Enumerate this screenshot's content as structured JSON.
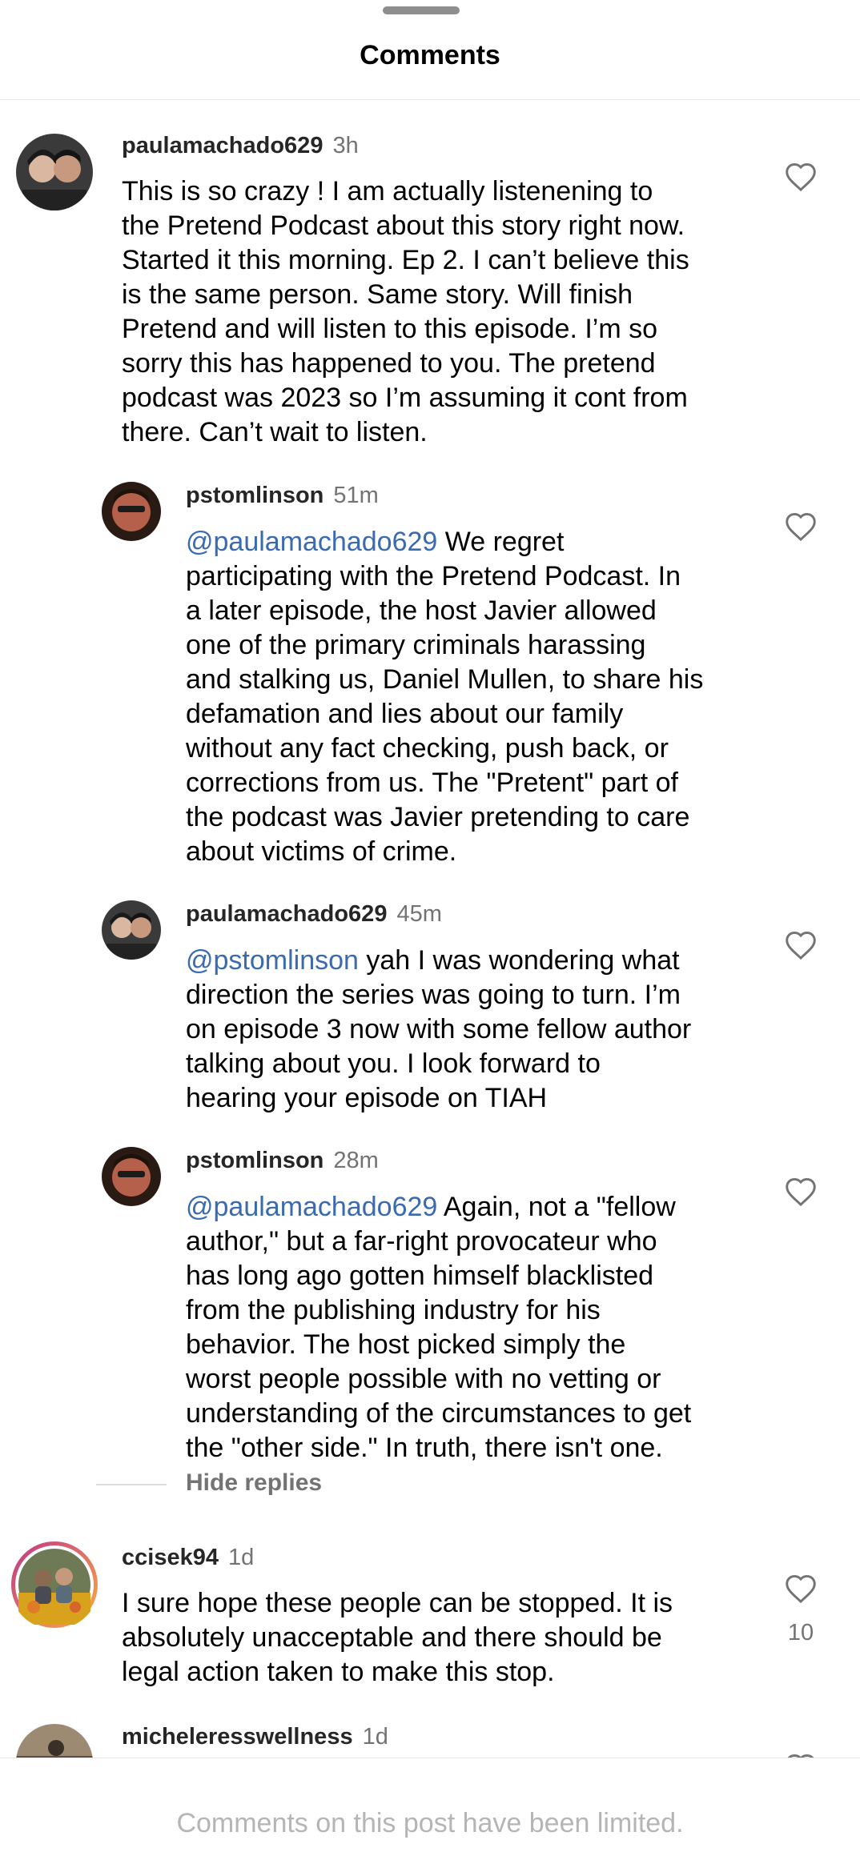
{
  "header": {
    "title": "Comments"
  },
  "comments": [
    {
      "username": "paulamachado629",
      "time": "3h",
      "mention": "",
      "text": "This is so crazy ! I am actually listenening to\nthe Pretend Podcast about this story right now.\nStarted it this morning. Ep 2. I can’t believe this\nis the same person. Same story. Will finish\nPretend and will listen to this episode. I’m so\nsorry this has happened to you. The pretend\npodcast was 2023 so I’m assuming it cont from\nthere. Can’t wait to listen."
    },
    {
      "username": "pstomlinson",
      "time": "51m",
      "mention": "@paulamachado629",
      "text": " We regret\nparticipating with the Pretend Podcast. In\na later episode, the host Javier allowed\none of the primary criminals harassing\nand stalking us, Daniel Mullen, to share his\ndefamation and lies about our family\nwithout any fact checking, push back, or\ncorrections from us. The \"Pretent\" part of\nthe podcast was Javier pretending to care\nabout victims of crime."
    },
    {
      "username": "paulamachado629",
      "time": "45m",
      "mention": "@pstomlinson",
      "text": " yah I was wondering what\ndirection the series was going to turn. I’m\non episode 3 now with some fellow author\ntalking about you. I look forward to\nhearing your episode on TIAH"
    },
    {
      "username": "pstomlinson",
      "time": "28m",
      "mention": "@paulamachado629",
      "text": " Again, not a \"fellow\nauthor,\" but a far-right provocateur who\nhas long ago gotten himself blacklisted\nfrom the publishing industry for his\nbehavior. The host picked simply the\nworst people possible with no vetting or\nunderstanding of the circumstances to get\nthe \"other side.\" In truth, there isn't one."
    },
    {
      "username": "ccisek94",
      "time": "1d",
      "mention": "",
      "text": "I sure hope these people can be stopped. It is\nabsolutely unacceptable and there should be\nlegal action taken to make this stop.",
      "likes": "10"
    },
    {
      "username": "micheleresswellness",
      "time": "1d",
      "mention": "",
      "text": ""
    }
  ],
  "hide_replies": "Hide replies",
  "footer": {
    "text": "Comments on this post have been limited."
  },
  "icons": {
    "like": "heart-outline-icon"
  },
  "colors": {
    "mention": "#3a6ab0",
    "muted": "#737373",
    "story_ring_start": "#c13584",
    "story_ring_end": "#fcaf45"
  }
}
